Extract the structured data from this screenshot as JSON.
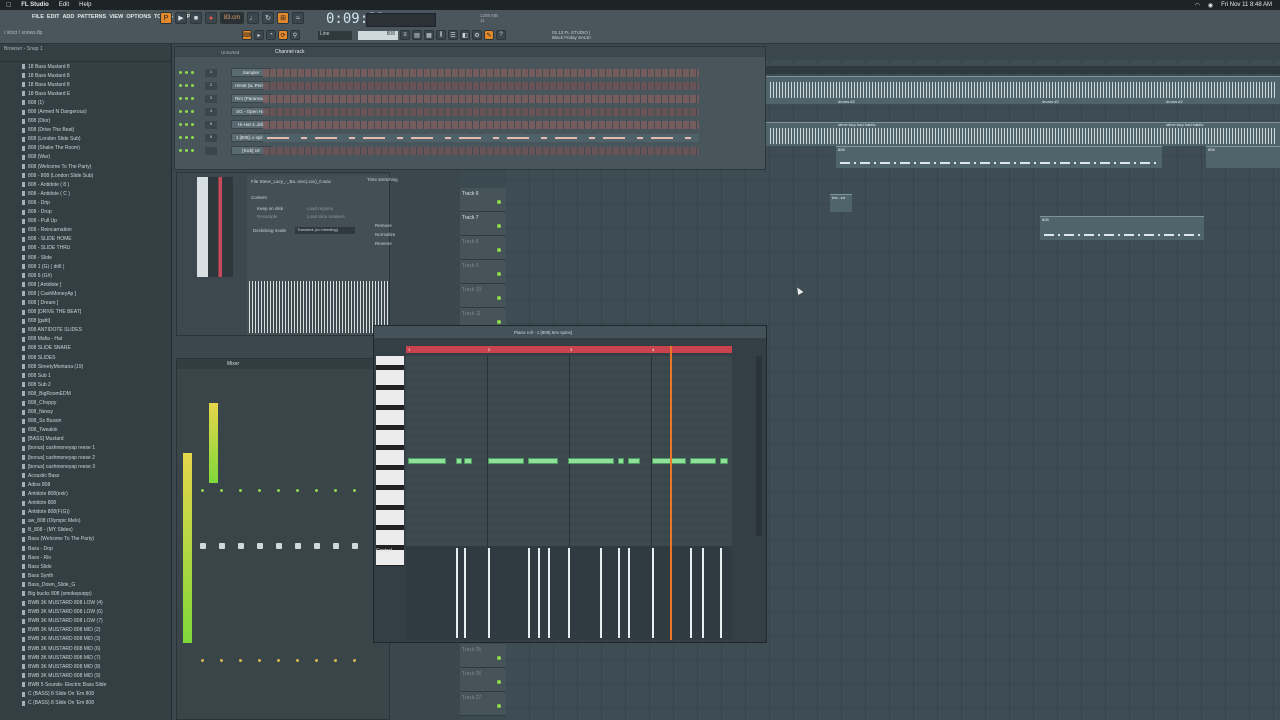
{
  "menubar": {
    "app_name": "FL Studio",
    "items": [
      "Edit",
      "Help"
    ],
    "datetime": "Fri Nov 11  8:48 AM"
  },
  "fl": {
    "menu": [
      "FILE",
      "EDIT",
      "ADD",
      "PATTERNS",
      "VIEW",
      "OPTIONS",
      "TOOLS",
      "HELP"
    ],
    "hint": "/ strict / snows.flp",
    "tempo": "83.cm",
    "time": "0:09:32",
    "pattern": "Line",
    "pattern_num": "808",
    "news": [
      "02.13  FL STUDIO |",
      "Black Friday SALE!"
    ],
    "cpu": [
      "1289 MB",
      "11"
    ]
  },
  "browser": {
    "header": "Browser - Snap 1",
    "items": [
      "18 Bass Mustard 8",
      "18 Bass Mustard 8",
      "18 Bass Mustard 8",
      "18 Bass Mustard E",
      "808 (1)",
      "808 (Armed N Dangerous)",
      "808 (Dior)",
      "808 (Drive The Beat)",
      "808 (London Slide Sub)",
      "808 (Shake The Room)",
      "808 (War)",
      "808 (Welcome To The Party)",
      "808 - 808 (London Slide Sub)",
      "808 - Antidote ( 8 )",
      "808 - Antidote ( C )",
      "808 - Drip",
      "808 - Drop",
      "808 - Pull Up",
      "808 - Reincarnation",
      "808 - SLIDE HOME",
      "808 - SLIDE THRU",
      "808 - Slide",
      "808 1 (G) ( drill )",
      "808 6 (G#)",
      "808 [ Antidote ]",
      "808 [ CashMoneyAp ]",
      "808 [ Dream ]",
      "808 [DRIVE THE BEAT]",
      "808 [gatti]",
      "808 ANTIDOTE SLIDES",
      "808 Mafia - Hat",
      "808 SLIDE SNARE",
      "808 SLIDES",
      "808 StreetyMontana (19)",
      "808 Sub 1",
      "808 Sub 2",
      "808_BigRoomEDM",
      "808_Choppy",
      "808_Nessy",
      "808_Ss Bussin",
      "808_Tweakin",
      "[BASS] Mustard",
      "[bonus] cashmoneyap reese 1",
      "[bonus] cashmoneyap reese 2",
      "[bonus] cashmoneyap reese 3",
      "Acoustic Bass",
      "Adios 808",
      "Antidote 808(extr)",
      "Antidote 808",
      "Antidote 808(F(G))",
      "aw_808 (Olympic Melo)",
      "B_808 - (MY Slides)",
      "Bass (Welcome To The Party)",
      "Bass - Dop",
      "Bass - Rio",
      "Bass Slide",
      "Bass Synth",
      "Bass_Down_Slide_G",
      "Big bucks 808 (smokepurpp)",
      "BWB 3K MUSTARD 808 LOW (4)",
      "BWB 3K MUSTARD 808 LOW (6)",
      "BWB 3K MUSTARD 808 LOW (7)",
      "BWB 3K MUSTARD 808 MID (2)",
      "BWB 3K MUSTARD 808 MID (3)",
      "BWB 3K MUSTARD 808 MID (6)",
      "BWB 3K MUSTARD 808 MID (7)",
      "BWB 3K MUSTARD 808 MID (8)",
      "BWB 3K MUSTARD 808 MID (9)",
      "BWB 5 Sounds- Electric Bass Slide",
      "C (BASS) 8 Slide On 'Em 808",
      "C (BASS) 8 Slide On 'Em 808"
    ]
  },
  "playlist": {
    "tracks": [
      "Track 6",
      "Track 7",
      "Track 8",
      "Track 9",
      "Track 10",
      "Track 11"
    ],
    "lower_tracks": [
      "Track 25",
      "Track 26",
      "Track 27"
    ],
    "clips": [
      "drums #2",
      "drums #2",
      "drums #2",
      "steve lacy bad habits",
      "steve lacy bad habits",
      "808",
      "808",
      "Ins...ed",
      "808"
    ]
  },
  "channel_rack": {
    "title": "Channel rack",
    "unsorted": "Unsorted",
    "channels": [
      {
        "num": "1",
        "name": "Sampler"
      },
      {
        "num": "2",
        "name": "HiHat (w..Perry)"
      },
      {
        "num": "3",
        "name": "Rim (Paramour)"
      },
      {
        "num": "4",
        "name": "SG - Open Hat"
      },
      {
        "num": "5",
        "name": "Hi-Hat 3..drill"
      },
      {
        "num": "9",
        "name": "1 [808]..v spins"
      },
      {
        "num": "",
        "name": "[Kick] 19"
      }
    ]
  },
  "sampler": {
    "file": "File  Steve_Lacy_-_Ba..msc(.xxx)_0.wav",
    "content": "Content",
    "keep_on_disk": "Keep on disk",
    "resample": "Resample",
    "load_regions": "Load regions",
    "load_slice_markers": "Load slice markers",
    "declicking": "Declicking mode",
    "declicking_value": "Transient (no bleeding)",
    "time_stretch": "Time stretching",
    "options": [
      "Remove",
      "Normalize",
      "Reverse"
    ]
  },
  "mixer": {
    "title": "Mixer"
  },
  "piano_roll": {
    "title": "Piano roll - 1 [808] 5ev spins)",
    "control": "Control",
    "ruler_marks": [
      "1",
      "2",
      "3",
      "4"
    ]
  }
}
